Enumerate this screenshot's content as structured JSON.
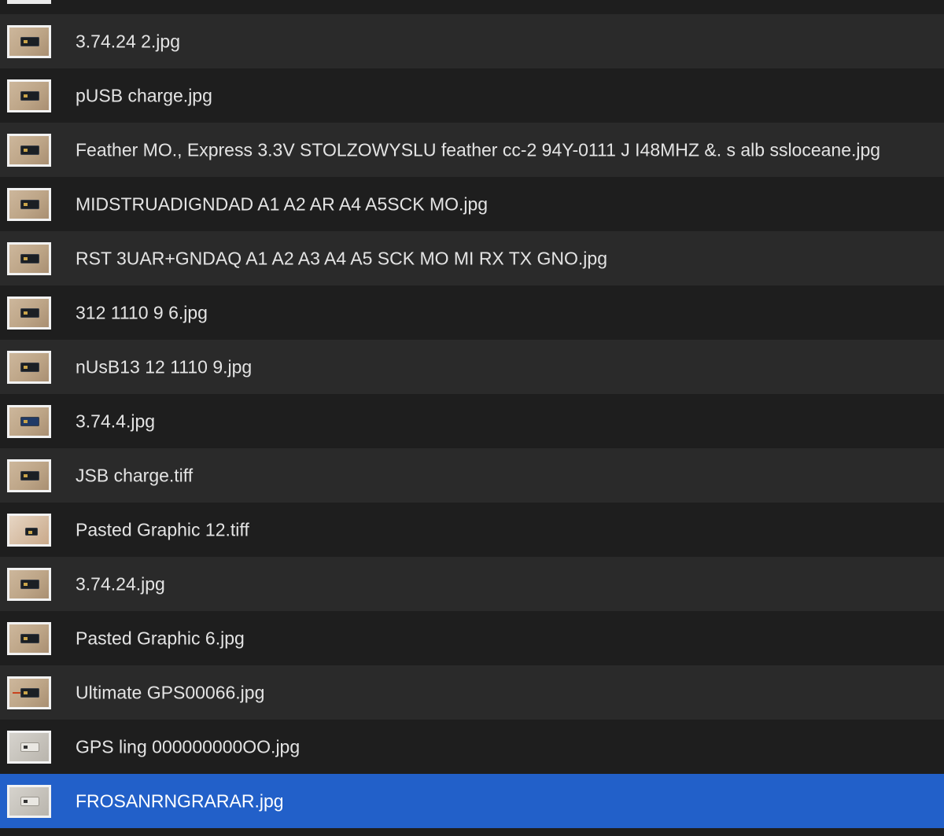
{
  "files": [
    {
      "name": "3.74.24 2.jpg",
      "thumb": "board"
    },
    {
      "name": "pUSB charge.jpg",
      "thumb": "board"
    },
    {
      "name": "Feather MO., Express 3.3V STOLZOWYSLU feather cc-2 94Y-0111 J I48MHZ &. s alb ssloceane.jpg",
      "thumb": "board"
    },
    {
      "name": "MIDSTRUADIGNDAD A1 A2 AR A4 A5SCK MO.jpg",
      "thumb": "board"
    },
    {
      "name": "RST 3UAR+GNDAQ A1 A2 A3 A4 A5 SCK MO MI RX TX GNO.jpg",
      "thumb": "board"
    },
    {
      "name": "312 1110 9 6.jpg",
      "thumb": "board"
    },
    {
      "name": "nUsB13 12 1110 9.jpg",
      "thumb": "board"
    },
    {
      "name": "3.74.4.jpg",
      "thumb": "blue"
    },
    {
      "name": "JSB charge.tiff",
      "thumb": "board"
    },
    {
      "name": "Pasted Graphic 12.tiff",
      "thumb": "hand"
    },
    {
      "name": "3.74.24.jpg",
      "thumb": "board"
    },
    {
      "name": "Pasted Graphic 6.jpg",
      "thumb": "board"
    },
    {
      "name": "Ultimate GPS00066.jpg",
      "thumb": "wire"
    },
    {
      "name": "GPS ling 000000000OO.jpg",
      "thumb": "breadboard"
    },
    {
      "name": "FROSANRNGRARAR.jpg",
      "thumb": "breadboard",
      "selected": true
    }
  ],
  "colors": {
    "background": "#1e1e1e",
    "alt_row": "#2a2a2a",
    "selection": "#2260c9",
    "text": "#e4e4e4"
  }
}
